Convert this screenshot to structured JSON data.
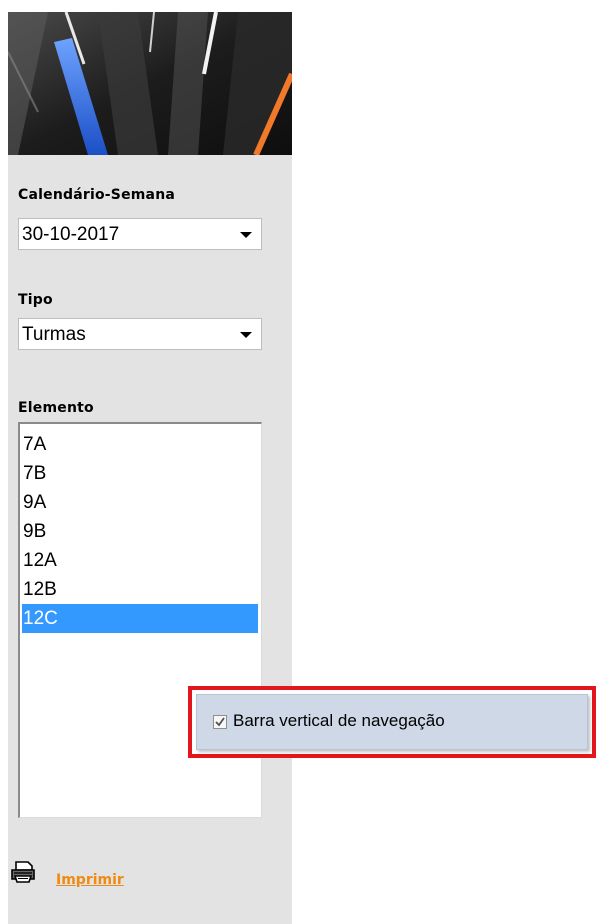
{
  "sidebar": {
    "banner": {
      "icon": "decorative-banner-image"
    },
    "calendar": {
      "label": "Calendário-Semana",
      "value": "30-10-2017"
    },
    "type": {
      "label": "Tipo",
      "value": "Turmas"
    },
    "element": {
      "label": "Elemento",
      "items": [
        {
          "label": "7A"
        },
        {
          "label": "7B"
        },
        {
          "label": "9A"
        },
        {
          "label": "9B"
        },
        {
          "label": "12A"
        },
        {
          "label": "12B"
        },
        {
          "label": "12C"
        }
      ],
      "selected": "12C"
    },
    "print": {
      "label": "Imprimir",
      "icon": "printer-icon"
    }
  },
  "context_menu": {
    "checkbox_label": "Barra vertical de navegação",
    "checked": true
  },
  "colors": {
    "sidebar_bg": "#e3e3e3",
    "selection": "#3399ff",
    "link": "#ef8a14",
    "highlight_border": "#e3151d",
    "menu_bg": "#ced8e7"
  }
}
